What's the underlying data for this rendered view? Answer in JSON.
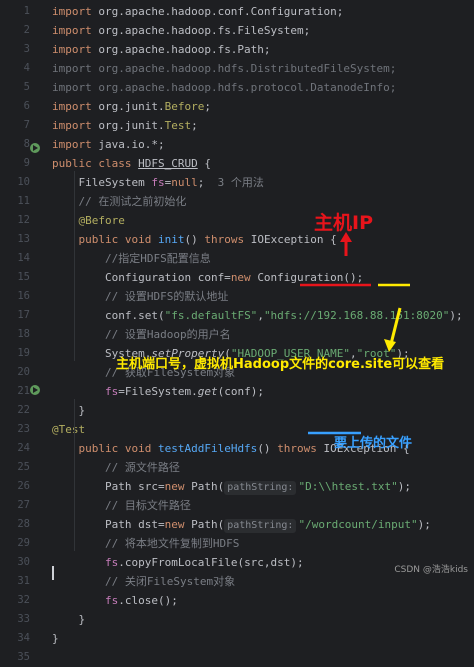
{
  "lines": [
    {
      "n": "1",
      "parts": [
        [
          "kw",
          "import "
        ],
        [
          "",
          "org.apache.hadoop.conf.Configuration;"
        ]
      ]
    },
    {
      "n": "2",
      "parts": [
        [
          "kw",
          "import "
        ],
        [
          "",
          "org.apache.hadoop.fs.FileSystem;"
        ]
      ]
    },
    {
      "n": "3",
      "parts": [
        [
          "kw",
          "import "
        ],
        [
          "",
          "org.apache.hadoop.fs.Path;"
        ]
      ]
    },
    {
      "n": "4",
      "parts": [
        [
          "grey",
          "import org.apache.hadoop.hdfs.DistributedFileSystem;"
        ]
      ]
    },
    {
      "n": "5",
      "parts": [
        [
          "grey",
          "import org.apache.hadoop.hdfs.protocol.DatanodeInfo;"
        ]
      ]
    },
    {
      "n": "6",
      "parts": [
        [
          "kw",
          "import "
        ],
        [
          "",
          "org.junit."
        ],
        [
          "ann",
          "Before"
        ],
        [
          "",
          ";"
        ]
      ]
    },
    {
      "n": "7",
      "parts": [
        [
          "kw",
          "import "
        ],
        [
          "",
          "org.junit."
        ],
        [
          "ann",
          "Test"
        ],
        [
          "",
          ";"
        ]
      ]
    },
    {
      "n": "8",
      "parts": [
        [
          "kw",
          "import "
        ],
        [
          "",
          "java.io.*;"
        ]
      ]
    },
    {
      "n": "9",
      "parts": [
        [
          "kw",
          "public class "
        ],
        [
          "hl-under",
          "HDFS_CRUD"
        ],
        [
          "",
          " {"
        ]
      ]
    },
    {
      "n": "10",
      "parts": [
        [
          "",
          "    FileSystem "
        ],
        [
          "field",
          "fs"
        ],
        [
          "",
          "="
        ],
        [
          "kw",
          "null"
        ],
        [
          "",
          ";  "
        ],
        [
          "cmt",
          "3 个用法"
        ]
      ]
    },
    {
      "n": "11",
      "parts": [
        [
          "cmt",
          "    // 在测试之前初始化"
        ]
      ]
    },
    {
      "n": "12",
      "parts": [
        [
          "ann",
          "    @Before"
        ]
      ]
    },
    {
      "n": "13",
      "parts": [
        [
          "kw",
          "    public void "
        ],
        [
          "fn",
          "init"
        ],
        [
          "",
          "() "
        ],
        [
          "kw",
          "throws "
        ],
        [
          "",
          "IOException {"
        ]
      ]
    },
    {
      "n": "14",
      "parts": [
        [
          "cmt",
          "        //指定HDFS配置信息"
        ]
      ]
    },
    {
      "n": "15",
      "parts": [
        [
          "",
          "        Configuration conf="
        ],
        [
          "kw",
          "new "
        ],
        [
          "",
          "Configuration();"
        ]
      ]
    },
    {
      "n": "16",
      "parts": [
        [
          "cmt",
          "        // 设置HDFS的默认地址"
        ]
      ]
    },
    {
      "n": "17",
      "parts": [
        [
          "",
          "        conf.set("
        ],
        [
          "str",
          "\"fs.defaultFS\""
        ],
        [
          "",
          ","
        ],
        [
          "str",
          "\"hdfs://192.168.88.151:8020\""
        ],
        [
          "",
          ");"
        ]
      ]
    },
    {
      "n": "18",
      "parts": [
        [
          "cmt",
          "        // 设置Hadoop的用户名"
        ]
      ]
    },
    {
      "n": "19",
      "parts": [
        [
          "",
          "        System."
        ],
        [
          "italic",
          "setProperty"
        ],
        [
          "",
          "("
        ],
        [
          "str",
          "\"HADOOP_USER_NAME\""
        ],
        [
          "",
          ","
        ],
        [
          "str",
          "\"root\""
        ],
        [
          "",
          ");"
        ]
      ]
    },
    {
      "n": "20",
      "parts": [
        [
          "cmt",
          "        // 获取FileSystem对象"
        ]
      ]
    },
    {
      "n": "21",
      "parts": [
        [
          "",
          "        "
        ],
        [
          "field",
          "fs"
        ],
        [
          "",
          "=FileSystem."
        ],
        [
          "italic",
          "get"
        ],
        [
          "",
          "(conf);"
        ]
      ]
    },
    {
      "n": "22",
      "parts": [
        [
          "",
          "    }"
        ]
      ]
    },
    {
      "n": "23",
      "parts": [
        [
          "ann",
          "@Test"
        ]
      ]
    },
    {
      "n": "24",
      "parts": [
        [
          "kw",
          "    public void "
        ],
        [
          "fn",
          "testAddFileHdfs"
        ],
        [
          "",
          "() "
        ],
        [
          "kw",
          "throws "
        ],
        [
          "",
          "IOException {"
        ]
      ]
    },
    {
      "n": "25",
      "parts": [
        [
          "cmt",
          "        // 源文件路径"
        ]
      ]
    },
    {
      "n": "26",
      "parts": [
        [
          "",
          "        Path src="
        ],
        [
          "kw",
          "new "
        ],
        [
          "",
          "Path("
        ],
        [
          "hint",
          "pathString:"
        ],
        [
          "str",
          "\"D:\\\\htest.txt\""
        ],
        [
          "",
          ");"
        ]
      ]
    },
    {
      "n": "27",
      "parts": [
        [
          "cmt",
          "        // 目标文件路径"
        ]
      ]
    },
    {
      "n": "28",
      "parts": [
        [
          "",
          "        Path dst="
        ],
        [
          "kw",
          "new "
        ],
        [
          "",
          "Path("
        ],
        [
          "hint",
          "pathString:"
        ],
        [
          "str",
          "\"/wordcount/input\""
        ],
        [
          "",
          ");"
        ]
      ]
    },
    {
      "n": "29",
      "parts": [
        [
          "cmt",
          "        // 将本地文件复制到HDFS"
        ]
      ]
    },
    {
      "n": "30",
      "parts": [
        [
          "",
          "        "
        ],
        [
          "field",
          "fs"
        ],
        [
          "",
          ".copyFromLocalFile(src,dst);"
        ]
      ]
    },
    {
      "n": "31",
      "parts": [
        [
          "cmt",
          "        // 关闭FileSystem对象"
        ]
      ]
    },
    {
      "n": "32",
      "parts": [
        [
          "",
          "        "
        ],
        [
          "field",
          "fs"
        ],
        [
          "",
          ".close();"
        ]
      ]
    },
    {
      "n": "33",
      "parts": [
        [
          "",
          "    }"
        ]
      ]
    },
    {
      "n": "34",
      "parts": [
        [
          "",
          "}"
        ]
      ]
    },
    {
      "n": "35",
      "parts": [
        [
          "",
          ""
        ]
      ]
    }
  ],
  "annotations": {
    "host_ip": "主机IP",
    "port_note": "主机端口号，虚拟机Hadoop文件的core.site可以查看",
    "upload_note": "要上传的文件"
  },
  "watermark": "CSDN @浩浩kids",
  "colors": {
    "background": "#1e1f22",
    "annotation_red": "#e8141b",
    "annotation_yellow": "#ffea00",
    "annotation_blue": "#38a0ff"
  }
}
